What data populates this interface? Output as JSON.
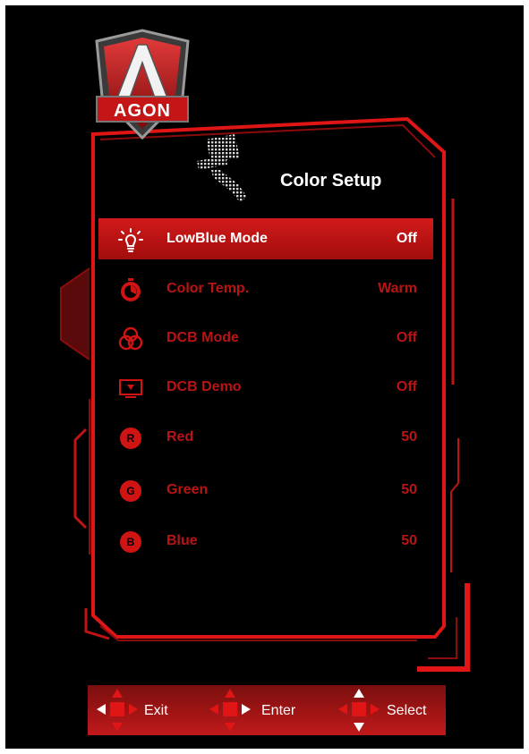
{
  "brand": {
    "logo_text": "AGON"
  },
  "header": {
    "title": "Color Setup",
    "icon": "paint-roller-icon"
  },
  "menu": {
    "items": [
      {
        "label": "LowBlue Mode",
        "value": "Off",
        "icon": "light-bulb-icon",
        "selected": true
      },
      {
        "label": "Color Temp.",
        "value": "Warm",
        "icon": "timer-icon",
        "selected": false
      },
      {
        "label": "DCB Mode",
        "value": "Off",
        "icon": "rgb-circles-icon",
        "selected": false
      },
      {
        "label": "DCB Demo",
        "value": "Off",
        "icon": "monitor-demo-icon",
        "selected": false
      },
      {
        "label": "Red",
        "value": "50",
        "icon": "R",
        "selected": false
      },
      {
        "label": "Green",
        "value": "50",
        "icon": "G",
        "selected": false
      },
      {
        "label": "Blue",
        "value": "50",
        "icon": "B",
        "selected": false
      }
    ]
  },
  "footer": {
    "exit_label": "Exit",
    "enter_label": "Enter",
    "select_label": "Select"
  },
  "colors": {
    "accent": "#e01515",
    "selected_bg": "#c01616",
    "inactive_text": "#b81414",
    "background": "#000000"
  }
}
